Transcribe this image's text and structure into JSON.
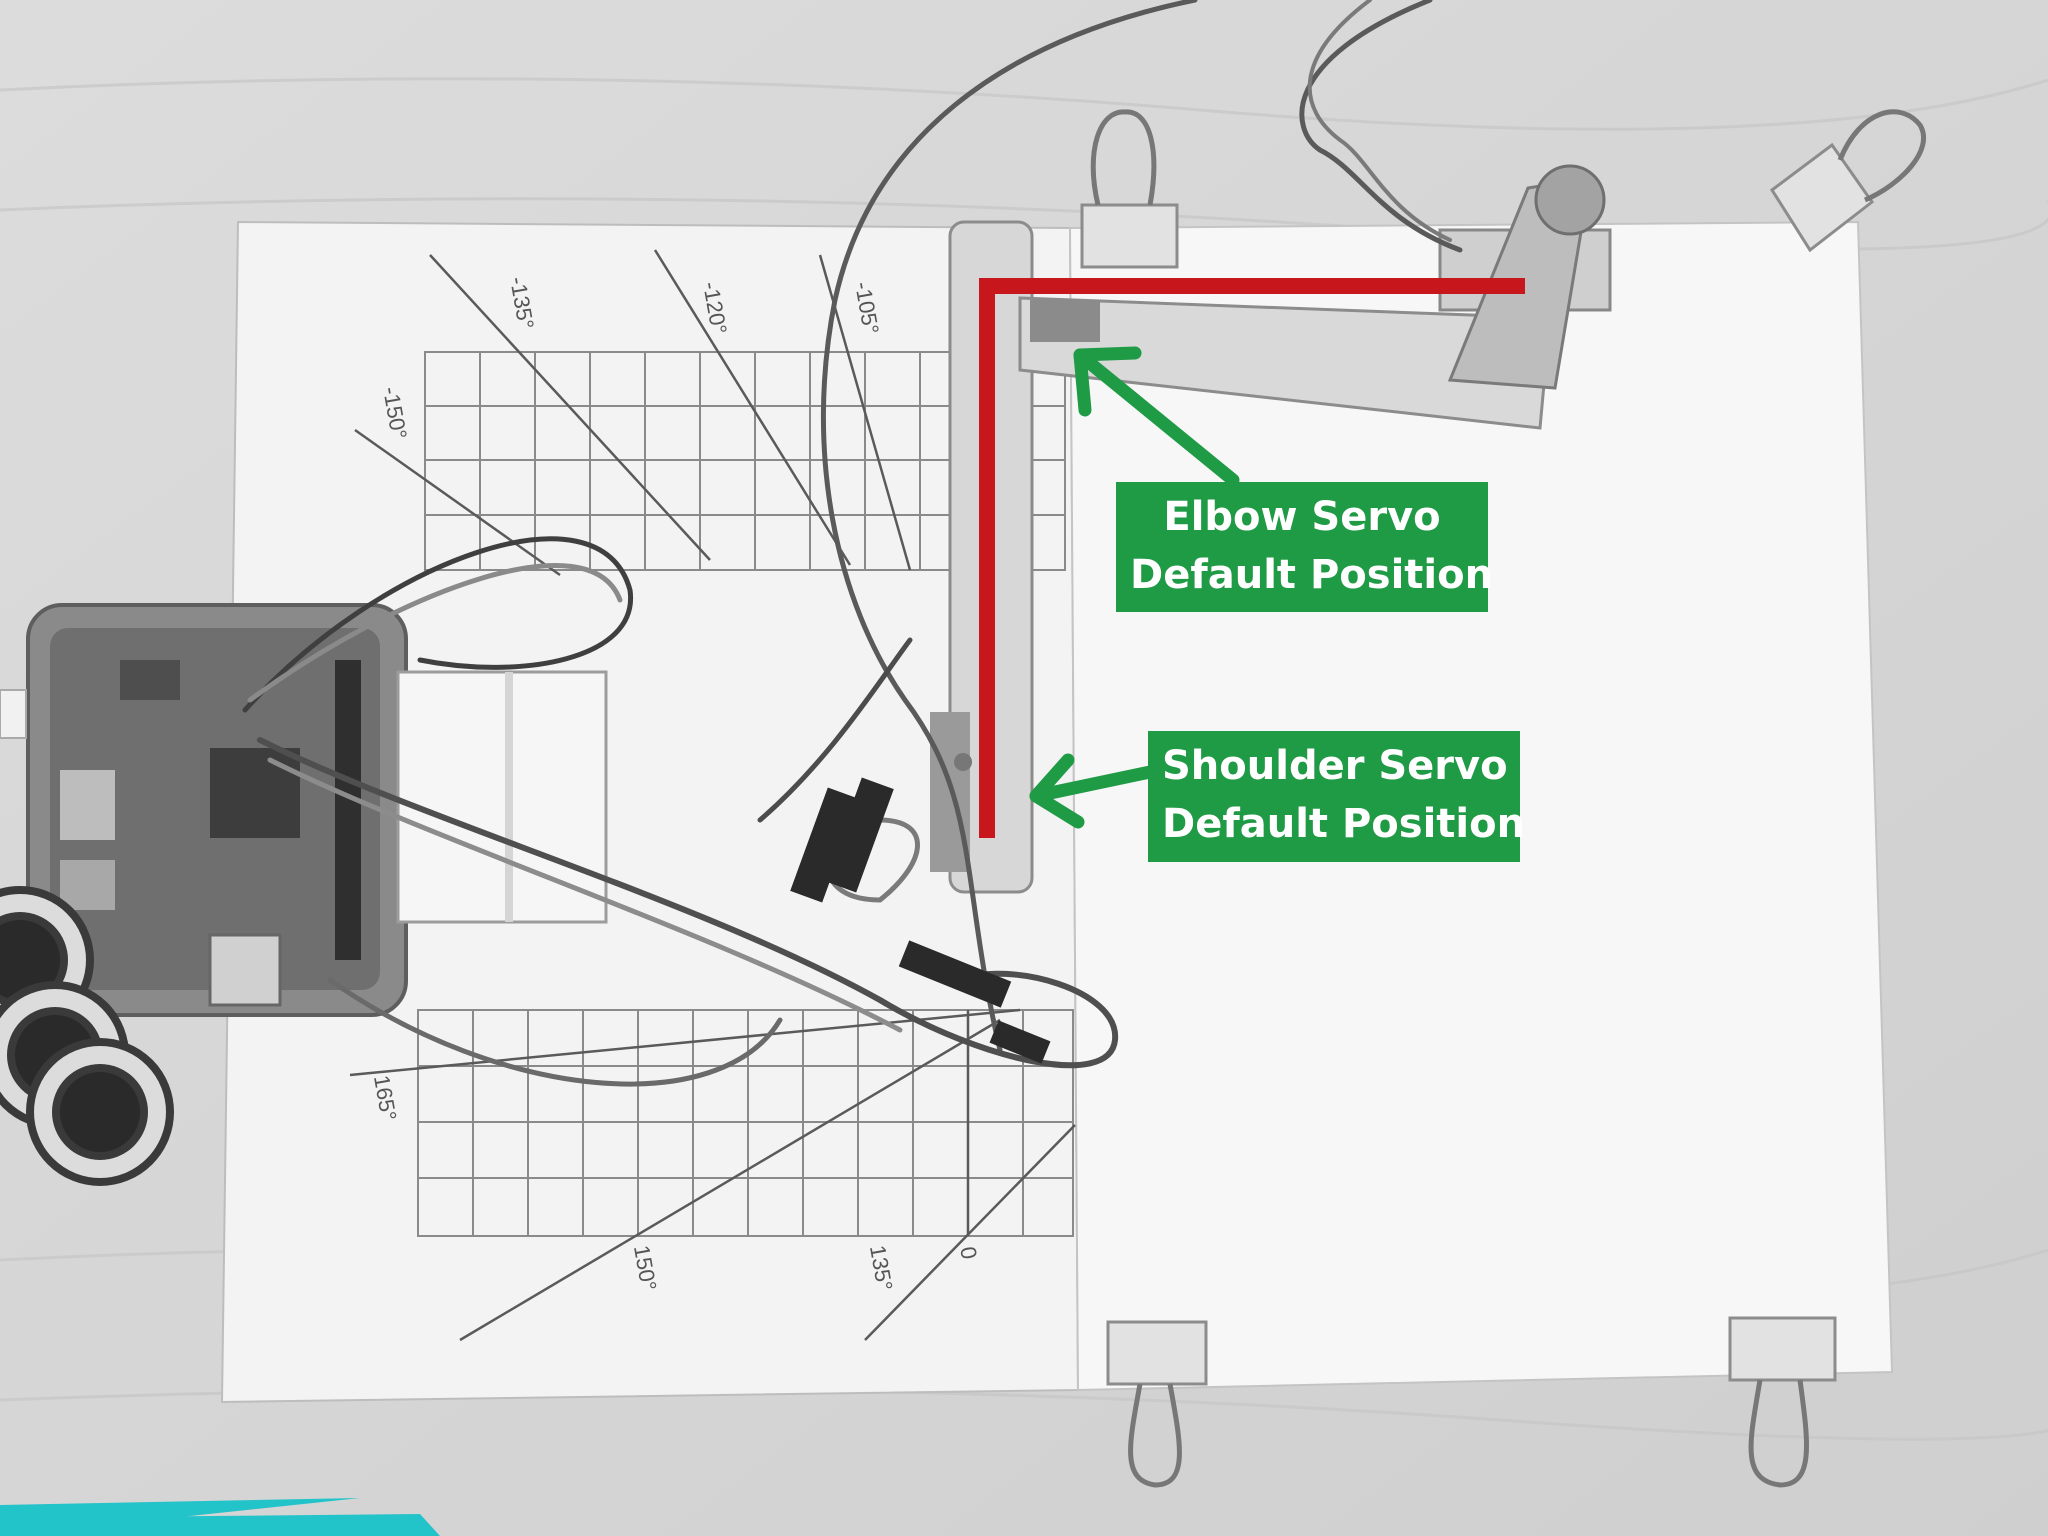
{
  "annotations": {
    "elbow": {
      "line1": "Elbow Servo",
      "line2": "Default Position"
    },
    "shoulder": {
      "line1": "Shoulder Servo",
      "line2": "Default Position"
    }
  },
  "grid_labels": {
    "top": [
      "-150°",
      "-135°",
      "-120°",
      "-105°"
    ],
    "bottom": [
      "165°",
      "150°",
      "135°",
      "0"
    ]
  },
  "colors": {
    "callout_green": "#1f9a45",
    "arm_red": "#c8161d",
    "accent_teal": "#22c3c9"
  }
}
